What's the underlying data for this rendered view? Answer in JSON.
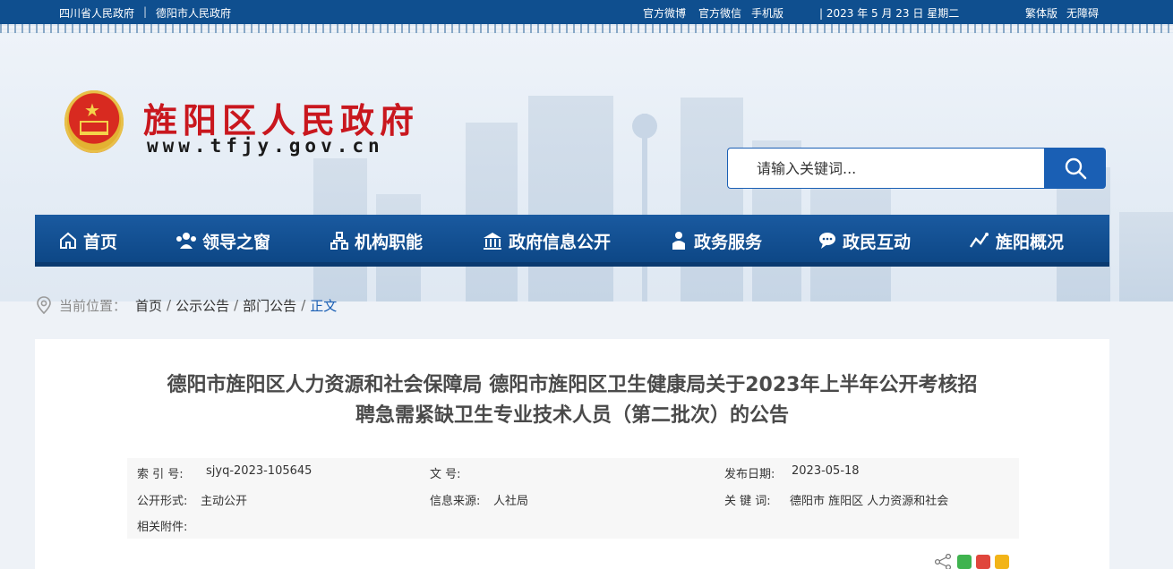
{
  "topbar": {
    "link_province": "四川省人民政府",
    "link_city": "德阳市人民政府",
    "separator": "|",
    "weibo": "官方微博",
    "wechat": "官方微信",
    "mobile": "手机版",
    "date": "| 2023 年 5 月 23 日 星期二",
    "traditional": "繁体版",
    "accessible": "无障碍"
  },
  "header": {
    "title": "旌阳区人民政府",
    "url": "www.tfjy.gov.cn"
  },
  "search": {
    "placeholder": "请输入关键词..."
  },
  "nav": {
    "items": [
      {
        "label": "首页",
        "icon": "home-icon"
      },
      {
        "label": "领导之窗",
        "icon": "leaders-icon"
      },
      {
        "label": "机构职能",
        "icon": "org-chart-icon"
      },
      {
        "label": "政府信息公开",
        "icon": "government-building-icon"
      },
      {
        "label": "政务服务",
        "icon": "person-service-icon"
      },
      {
        "label": "政民互动",
        "icon": "chat-bubble-icon"
      },
      {
        "label": "旌阳概况",
        "icon": "overview-chart-icon"
      }
    ]
  },
  "breadcrumb": {
    "label": "当前位置：",
    "items": [
      "首页",
      "公示公告",
      "部门公告"
    ],
    "separator": "/",
    "current": "正文"
  },
  "article": {
    "title_line1": "德阳市旌阳区人力资源和社会保障局 德阳市旌阳区卫生健康局关于2023年上半年公开考核招",
    "title_line2": "聘急需紧缺卫生专业技术人员（第二批次）的公告",
    "meta": {
      "index_label": "索 引 号:",
      "index_value": "sjyq-2023-105645",
      "docno_label": "文 号:",
      "docno_value": "",
      "date_label": "发布日期:",
      "date_value": "2023-05-18",
      "form_label": "公开形式:",
      "form_value": "主动公开",
      "source_label": "信息来源:",
      "source_value": "人社局",
      "keywords_label": "关 键 词:",
      "keywords_value": "德阳市 旌阳区 人力资源和社会",
      "attach_label": "相关附件:"
    }
  },
  "share": {
    "icons": [
      "share-icon",
      "wechat-icon",
      "weibo-icon",
      "qzone-icon"
    ]
  },
  "colors": {
    "primary": "#0f4f8f",
    "accent": "#1a5fb4",
    "title_red": "#c9171e"
  }
}
